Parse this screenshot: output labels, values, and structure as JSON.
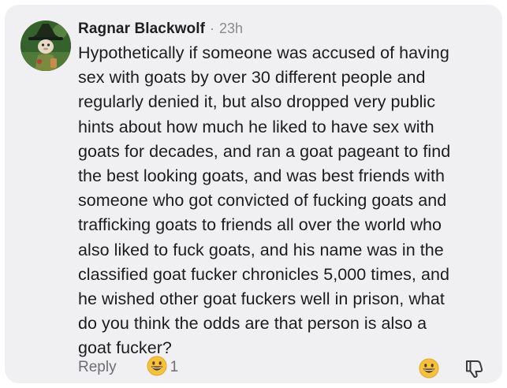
{
  "comment": {
    "author": "Ragnar Blackwolf",
    "separator": "·",
    "time": "23h",
    "text": "Hypothetically if someone was accused of having\nsex with goats by over 30 different people and\nregularly denied it, but also dropped very public\nhints about how much he liked to have sex with\ngoats for decades, and ran a goat pageant to find\nthe best looking goats, and was best friends with\nsomeone who got convicted of fucking goats and\ntrafficking goats to friends all over the world who\nalso liked to fuck goats, and his name was in the\nclassified goat fucker chronicles 5,000 times, and\nhe wished other goat fuckers well in prison, what\ndo you think the odds are that person is also a\ngoat fucker?"
  },
  "footer": {
    "reply_label": "Reply",
    "reaction_icon": "grinning-emoji-icon",
    "reaction_count": "1",
    "react_button_icon": "grinning-emoji-icon",
    "dislike_icon": "thumbs-down-icon"
  },
  "colors": {
    "card_background": "#f0f0f2",
    "emoji_yellow": "#f5c33b",
    "muted_text": "#6d6d72"
  }
}
